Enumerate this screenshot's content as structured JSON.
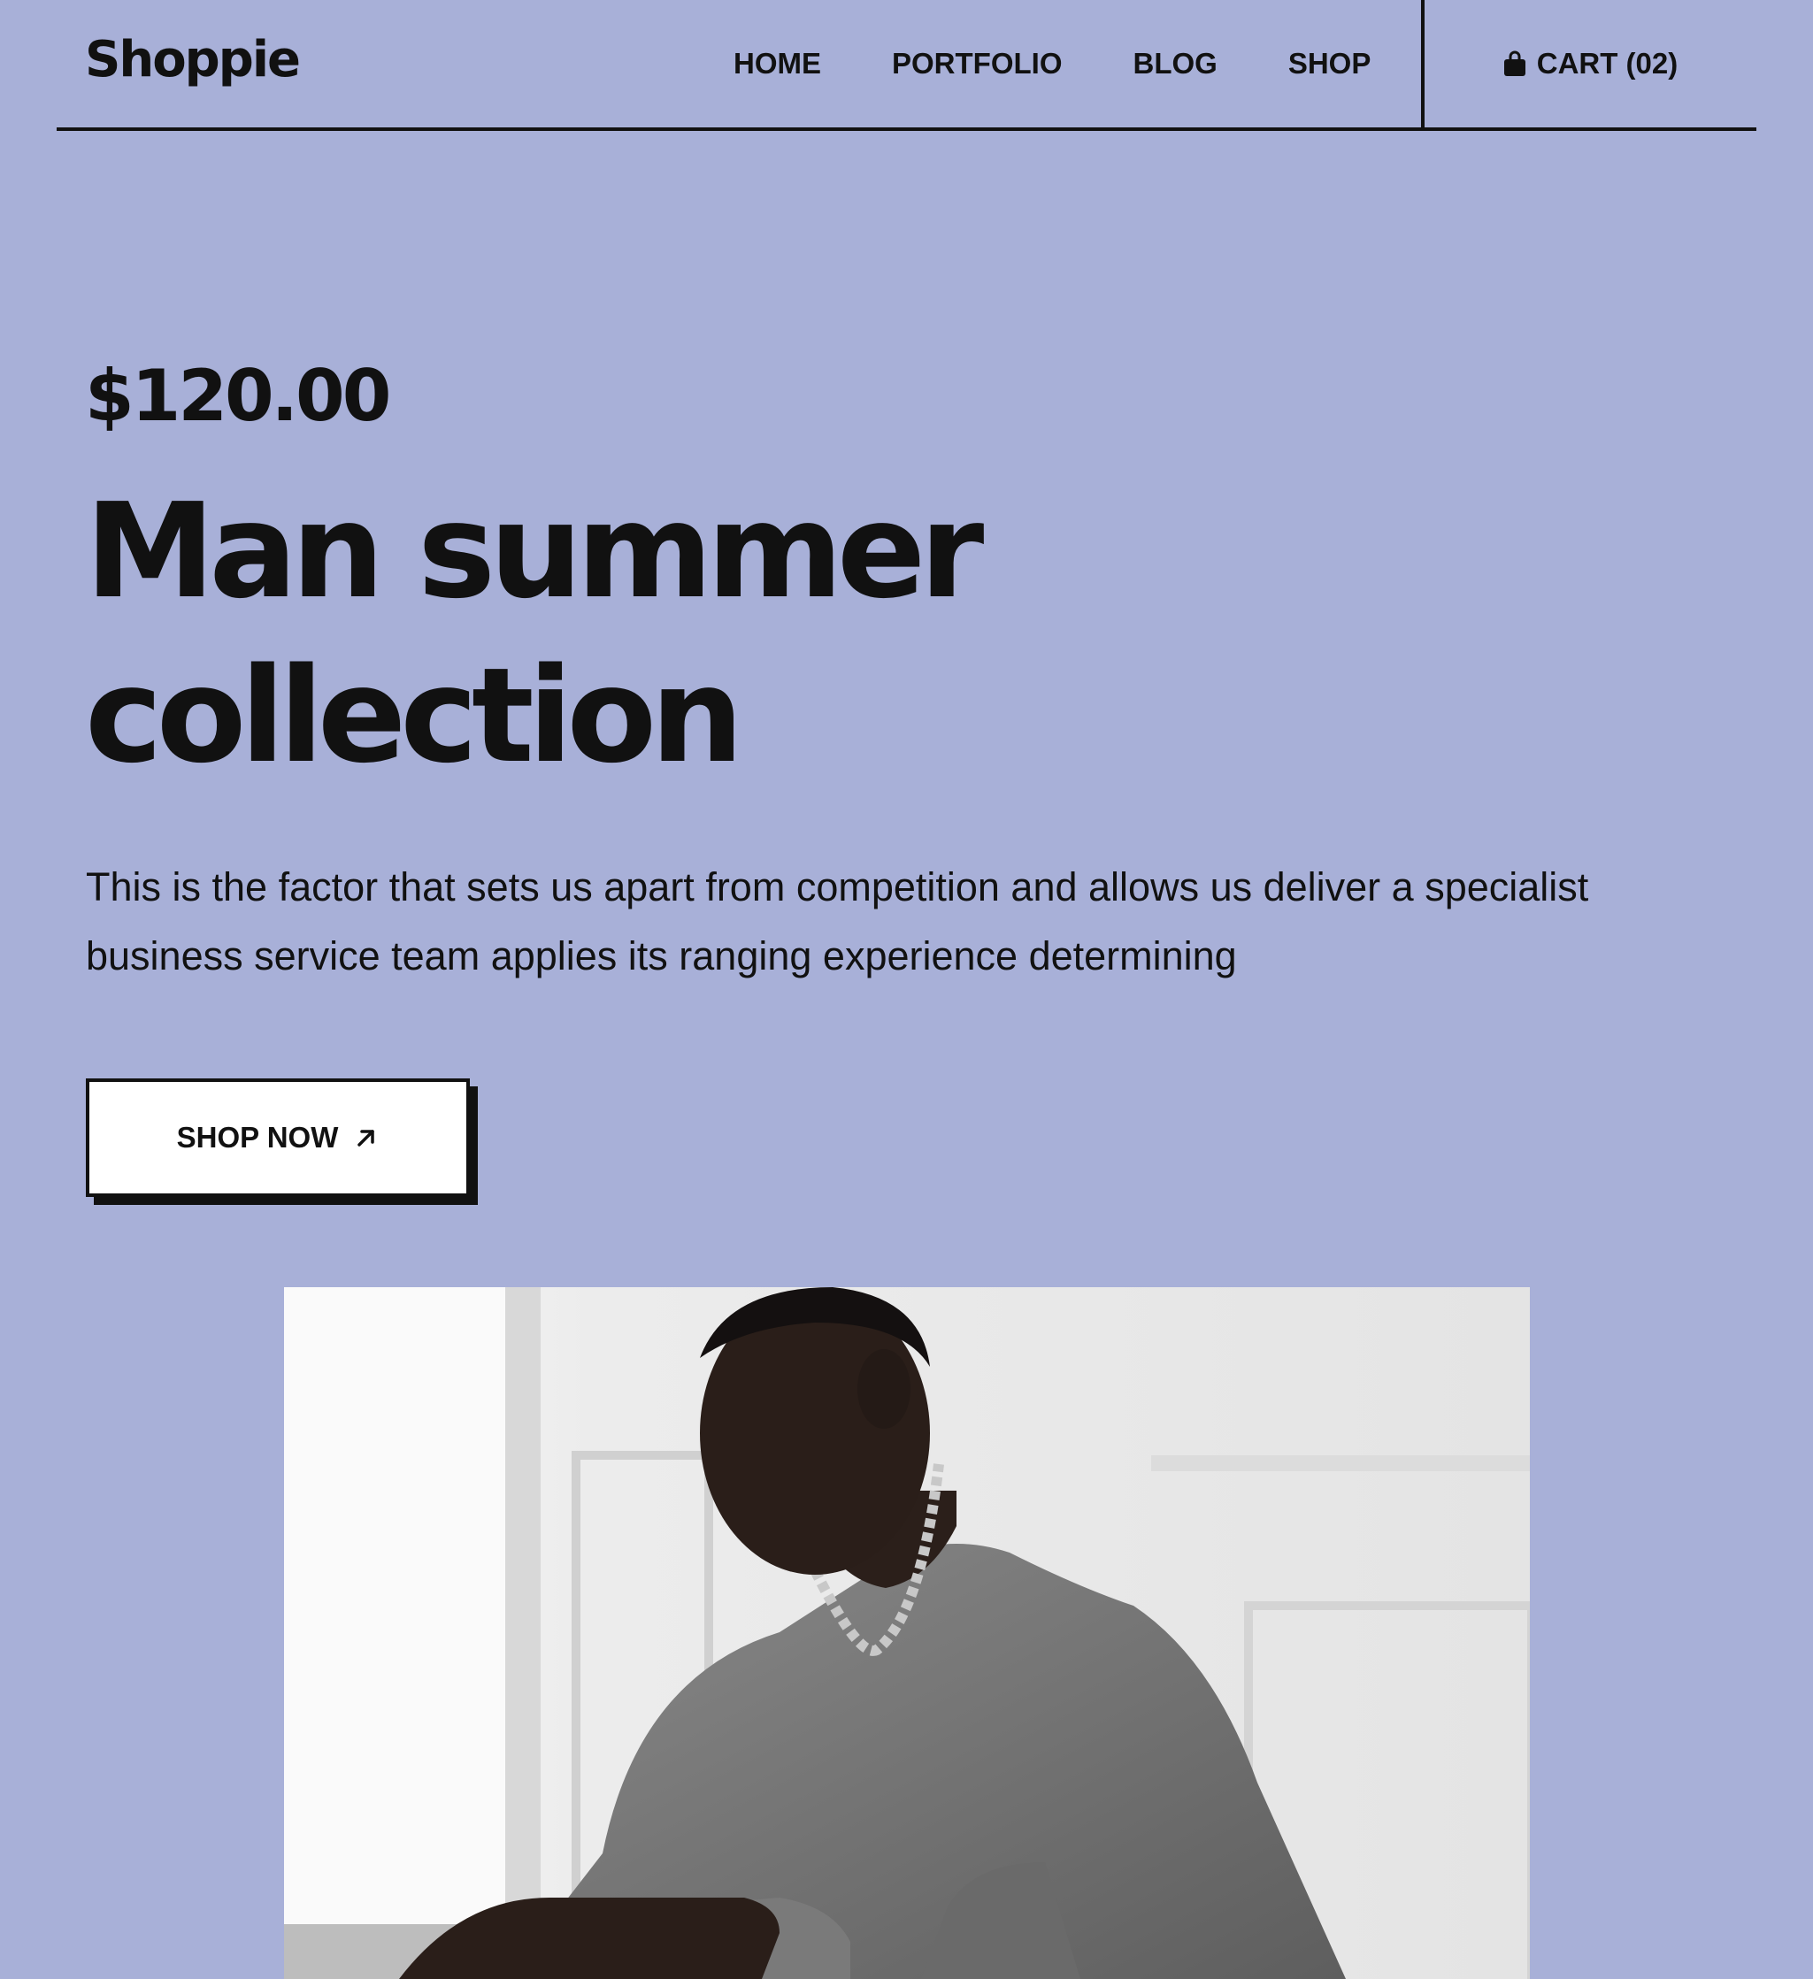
{
  "brand": {
    "logo_text": "Shoppie"
  },
  "nav": {
    "items": [
      {
        "label": "HOME"
      },
      {
        "label": "PORTFOLIO"
      },
      {
        "label": "BLOG"
      },
      {
        "label": "SHOP"
      }
    ]
  },
  "cart": {
    "label": "CART (02)",
    "icon": "shopping-bag-icon"
  },
  "hero": {
    "price": "$120.00",
    "title_line1": "Man summer",
    "title_line2": "collection",
    "description": "This is the factor that sets us apart from competition and allows us deliver a specialist business service team applies its ranging experience determining",
    "cta_label": "SHOP NOW",
    "cta_icon": "arrow-up-right-icon"
  },
  "colors": {
    "background": "#a8b0d8",
    "text": "#111111",
    "button_bg": "#ffffff"
  }
}
